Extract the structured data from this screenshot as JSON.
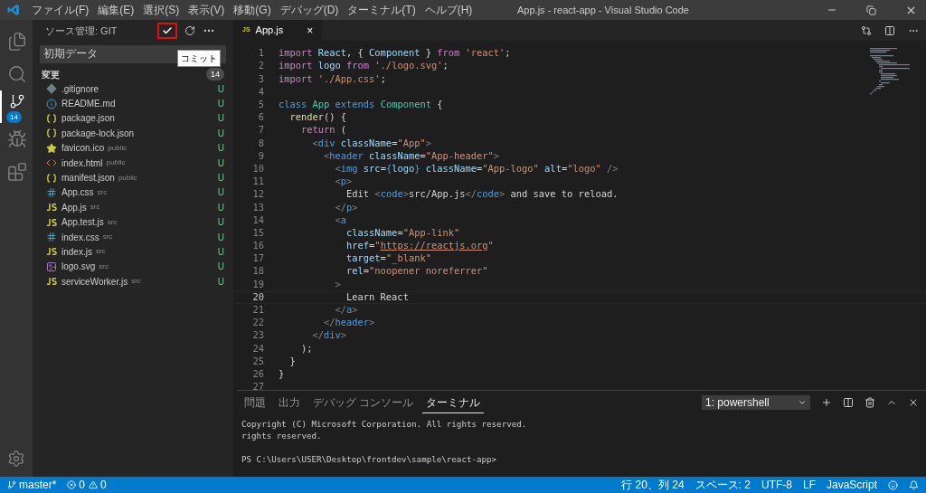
{
  "window": {
    "title": "App.js - react-app - Visual Studio Code"
  },
  "menu": [
    "ファイル(F)",
    "編集(E)",
    "選択(S)",
    "表示(V)",
    "移動(G)",
    "デバッグ(D)",
    "ターミナル(T)",
    "ヘルプ(H)"
  ],
  "activity_bar": [
    {
      "kind": "files",
      "selected": false
    },
    {
      "kind": "search",
      "selected": false
    },
    {
      "kind": "scm",
      "selected": true,
      "badge": "14"
    },
    {
      "kind": "debug",
      "selected": false
    },
    {
      "kind": "extensions",
      "selected": false
    }
  ],
  "sidebar": {
    "title": "ソース管理: GIT",
    "commit_tooltip": "コミット",
    "message": "初期データ",
    "group": {
      "label": "変更",
      "count": "14"
    },
    "files": [
      {
        "kind": "git",
        "name": ".gitignore",
        "status": "U"
      },
      {
        "kind": "info",
        "name": "README.md",
        "status": "U"
      },
      {
        "kind": "json",
        "name": "package.json",
        "status": "U"
      },
      {
        "kind": "json",
        "name": "package-lock.json",
        "status": "U"
      },
      {
        "kind": "star",
        "name": "favicon.ico",
        "folder": "public",
        "status": "U"
      },
      {
        "kind": "html",
        "name": "index.html",
        "folder": "public",
        "status": "U"
      },
      {
        "kind": "json",
        "name": "manifest.json",
        "folder": "public",
        "status": "U"
      },
      {
        "kind": "css",
        "name": "App.css",
        "folder": "src",
        "status": "U"
      },
      {
        "kind": "js",
        "name": "App.js",
        "folder": "src",
        "status": "U"
      },
      {
        "kind": "js",
        "name": "App.test.js",
        "folder": "src",
        "status": "U"
      },
      {
        "kind": "css",
        "name": "index.css",
        "folder": "src",
        "status": "U"
      },
      {
        "kind": "js",
        "name": "index.js",
        "folder": "src",
        "status": "U"
      },
      {
        "kind": "svg",
        "name": "logo.svg",
        "folder": "src",
        "status": "U"
      },
      {
        "kind": "js",
        "name": "serviceWorker.js",
        "folder": "src",
        "status": "U"
      }
    ]
  },
  "editor": {
    "tabs": [
      {
        "badge": "JS",
        "label": "App.js",
        "close": "×",
        "selected": true
      }
    ],
    "lines": [
      {
        "n": "1",
        "current": false,
        "tokens": [
          {
            "kind": "kw",
            "t": "import "
          },
          {
            "kind": "var",
            "t": "React"
          },
          {
            "kind": "p",
            "t": ", { "
          },
          {
            "kind": "var",
            "t": "Component"
          },
          {
            "kind": "p",
            "t": " } "
          },
          {
            "kind": "kw",
            "t": "from "
          },
          {
            "kind": "str",
            "t": "'react'"
          },
          {
            "kind": "p",
            "t": ";"
          }
        ]
      },
      {
        "n": "2",
        "current": false,
        "tokens": [
          {
            "kind": "kw",
            "t": "import "
          },
          {
            "kind": "var",
            "t": "logo "
          },
          {
            "kind": "kw",
            "t": "from "
          },
          {
            "kind": "str",
            "t": "'./logo.svg'"
          },
          {
            "kind": "p",
            "t": ";"
          }
        ]
      },
      {
        "n": "3",
        "current": false,
        "tokens": [
          {
            "kind": "kw",
            "t": "import "
          },
          {
            "kind": "str",
            "t": "'./App.css'"
          },
          {
            "kind": "p",
            "t": ";"
          }
        ]
      },
      {
        "n": "4",
        "current": false
      },
      {
        "n": "5",
        "current": false,
        "tokens": [
          {
            "kind": "blue",
            "t": "class "
          },
          {
            "kind": "cls",
            "t": "App "
          },
          {
            "kind": "blue",
            "t": "extends "
          },
          {
            "kind": "cls",
            "t": "Component"
          },
          {
            "kind": "p",
            "t": " {"
          }
        ]
      },
      {
        "n": "6",
        "current": false,
        "tokens": [
          {
            "kind": "fn",
            "t": "  render"
          },
          {
            "kind": "p",
            "t": "() {"
          }
        ]
      },
      {
        "n": "7",
        "current": false,
        "tokens": [
          {
            "kind": "kw",
            "t": "    return"
          },
          {
            "kind": "p",
            "t": " ("
          }
        ]
      },
      {
        "n": "8",
        "current": false,
        "tokens": [
          {
            "kind": "br",
            "t": "      <"
          },
          {
            "kind": "blue",
            "t": "div "
          },
          {
            "kind": "var",
            "t": "className"
          },
          {
            "kind": "p",
            "t": "="
          },
          {
            "kind": "str",
            "t": "\"App\""
          },
          {
            "kind": "br",
            "t": ">"
          }
        ]
      },
      {
        "n": "9",
        "current": false,
        "tokens": [
          {
            "kind": "br",
            "t": "        <"
          },
          {
            "kind": "blue",
            "t": "header "
          },
          {
            "kind": "var",
            "t": "className"
          },
          {
            "kind": "p",
            "t": "="
          },
          {
            "kind": "str",
            "t": "\"App-header\""
          },
          {
            "kind": "br",
            "t": ">"
          }
        ]
      },
      {
        "n": "10",
        "current": false,
        "tokens": [
          {
            "kind": "br",
            "t": "          <"
          },
          {
            "kind": "blue",
            "t": "img "
          },
          {
            "kind": "var",
            "t": "src"
          },
          {
            "kind": "p",
            "t": "="
          },
          {
            "kind": "blue",
            "t": "{"
          },
          {
            "kind": "var",
            "t": "logo"
          },
          {
            "kind": "blue",
            "t": "}"
          },
          {
            "kind": "var",
            "t": " className"
          },
          {
            "kind": "p",
            "t": "="
          },
          {
            "kind": "str",
            "t": "\"App-logo\""
          },
          {
            "kind": "var",
            "t": " alt"
          },
          {
            "kind": "p",
            "t": "="
          },
          {
            "kind": "str",
            "t": "\"logo\""
          },
          {
            "kind": "br",
            "t": " />"
          }
        ]
      },
      {
        "n": "11",
        "current": false,
        "tokens": [
          {
            "kind": "br",
            "t": "          <"
          },
          {
            "kind": "blue",
            "t": "p"
          },
          {
            "kind": "br",
            "t": ">"
          }
        ]
      },
      {
        "n": "12",
        "current": false,
        "tokens": [
          {
            "kind": "p",
            "t": "            Edit "
          },
          {
            "kind": "br",
            "t": "<"
          },
          {
            "kind": "blue",
            "t": "code"
          },
          {
            "kind": "br",
            "t": ">"
          },
          {
            "kind": "p",
            "t": "src/App.js"
          },
          {
            "kind": "br",
            "t": "</"
          },
          {
            "kind": "blue",
            "t": "code"
          },
          {
            "kind": "br",
            "t": ">"
          },
          {
            "kind": "p",
            "t": " and save to reload."
          }
        ]
      },
      {
        "n": "13",
        "current": false,
        "tokens": [
          {
            "kind": "br",
            "t": "          </"
          },
          {
            "kind": "blue",
            "t": "p"
          },
          {
            "kind": "br",
            "t": ">"
          }
        ]
      },
      {
        "n": "14",
        "current": false,
        "tokens": [
          {
            "kind": "br",
            "t": "          <"
          },
          {
            "kind": "blue",
            "t": "a"
          }
        ]
      },
      {
        "n": "15",
        "current": false,
        "tokens": [
          {
            "kind": "var",
            "t": "            className"
          },
          {
            "kind": "p",
            "t": "="
          },
          {
            "kind": "str",
            "t": "\"App-link\""
          }
        ]
      },
      {
        "n": "16",
        "current": false,
        "tokens": [
          {
            "kind": "var",
            "t": "            href"
          },
          {
            "kind": "p",
            "t": "="
          },
          {
            "kind": "str",
            "t": "\""
          },
          {
            "kind": "link",
            "t": "https://reactjs.org"
          },
          {
            "kind": "str",
            "t": "\""
          }
        ]
      },
      {
        "n": "17",
        "current": false,
        "tokens": [
          {
            "kind": "var",
            "t": "            target"
          },
          {
            "kind": "p",
            "t": "="
          },
          {
            "kind": "str",
            "t": "\"_blank\""
          }
        ]
      },
      {
        "n": "18",
        "current": false,
        "tokens": [
          {
            "kind": "var",
            "t": "            rel"
          },
          {
            "kind": "p",
            "t": "="
          },
          {
            "kind": "str",
            "t": "\"noopener noreferrer\""
          }
        ]
      },
      {
        "n": "19",
        "current": false,
        "tokens": [
          {
            "kind": "br",
            "t": "          >"
          }
        ]
      },
      {
        "n": "20",
        "current": true,
        "tokens": [
          {
            "kind": "p",
            "t": "            Learn React"
          }
        ]
      },
      {
        "n": "21",
        "current": false,
        "tokens": [
          {
            "kind": "br",
            "t": "          </"
          },
          {
            "kind": "blue",
            "t": "a"
          },
          {
            "kind": "br",
            "t": ">"
          }
        ]
      },
      {
        "n": "22",
        "current": false,
        "tokens": [
          {
            "kind": "br",
            "t": "        </"
          },
          {
            "kind": "blue",
            "t": "header"
          },
          {
            "kind": "br",
            "t": ">"
          }
        ]
      },
      {
        "n": "23",
        "current": false,
        "tokens": [
          {
            "kind": "br",
            "t": "      </"
          },
          {
            "kind": "blue",
            "t": "div"
          },
          {
            "kind": "br",
            "t": ">"
          }
        ]
      },
      {
        "n": "24",
        "current": false,
        "tokens": [
          {
            "kind": "p",
            "t": "    );"
          }
        ]
      },
      {
        "n": "25",
        "current": false,
        "tokens": [
          {
            "kind": "p",
            "t": "  }"
          }
        ]
      },
      {
        "n": "26",
        "current": false,
        "tokens": [
          {
            "kind": "p",
            "t": "}"
          }
        ]
      },
      {
        "n": "27",
        "current": false
      }
    ]
  },
  "panel": {
    "tabs": [
      {
        "label": "問題",
        "selected": false
      },
      {
        "label": "出力",
        "selected": false
      },
      {
        "label": "デバッグ コンソール",
        "selected": false
      },
      {
        "label": "ターミナル",
        "selected": true
      }
    ],
    "terminal_select": "1: powershell",
    "output": [
      "Copyright (C) Microsoft Corporation. All rights reserved.",
      "rights reserved."
    ],
    "prompt": "PS C:\\Users\\USER\\Desktop\\frontdev\\sample\\react-app>"
  },
  "status_bar": {
    "branch": "master*",
    "errors": "0",
    "warnings": "0",
    "right": [
      "行 20、列 24",
      "スペース: 2",
      "UTF-8",
      "LF",
      "JavaScript"
    ]
  }
}
